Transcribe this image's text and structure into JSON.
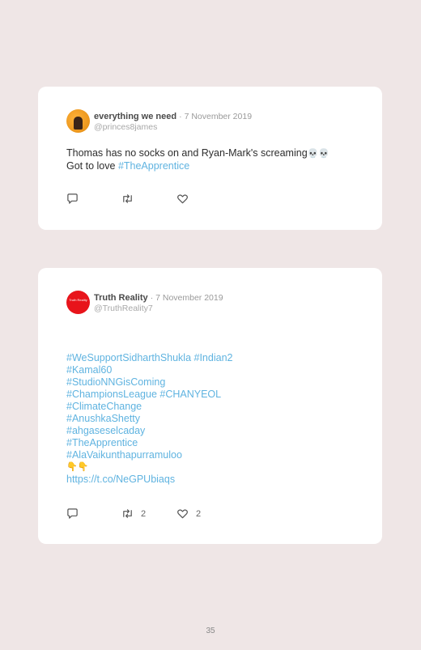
{
  "tweets": [
    {
      "display_name": "everything we need",
      "date": "· 7 November 2019",
      "handle": "@princes8james",
      "text_line1": "Thomas has no socks on and Ryan-Mark's screaming",
      "emojis": "💀💀",
      "text_line2_prefix": "Got to love ",
      "hashtag": "#TheApprentice",
      "retweets": "",
      "likes": ""
    },
    {
      "display_name": "Truth Reality",
      "date": "· 7 November 2019",
      "handle": "@TruthReality7",
      "avatar_text": "Truth Reality",
      "tags": [
        "#WeSupportSidharthShukla #Indian2",
        "#Kamal60",
        "#StudioNNGisComing",
        "#ChampionsLeague #CHANYEOL",
        "#ClimateChange",
        "#AnushkaShetty",
        "#ahgaseselcaday",
        "#TheApprentice",
        "#AlaVaikunthapurramuloo"
      ],
      "hands": "👇👇",
      "link": "https://t.co/NeGPUbiaqs",
      "retweets": "2",
      "likes": "2"
    }
  ],
  "page_number": "35",
  "icons": [
    "reply-icon",
    "retweet-icon",
    "like-icon"
  ],
  "colors": {
    "background": "#efe6e6",
    "hashtag": "#5fb3e0",
    "card": "#ffffff"
  }
}
